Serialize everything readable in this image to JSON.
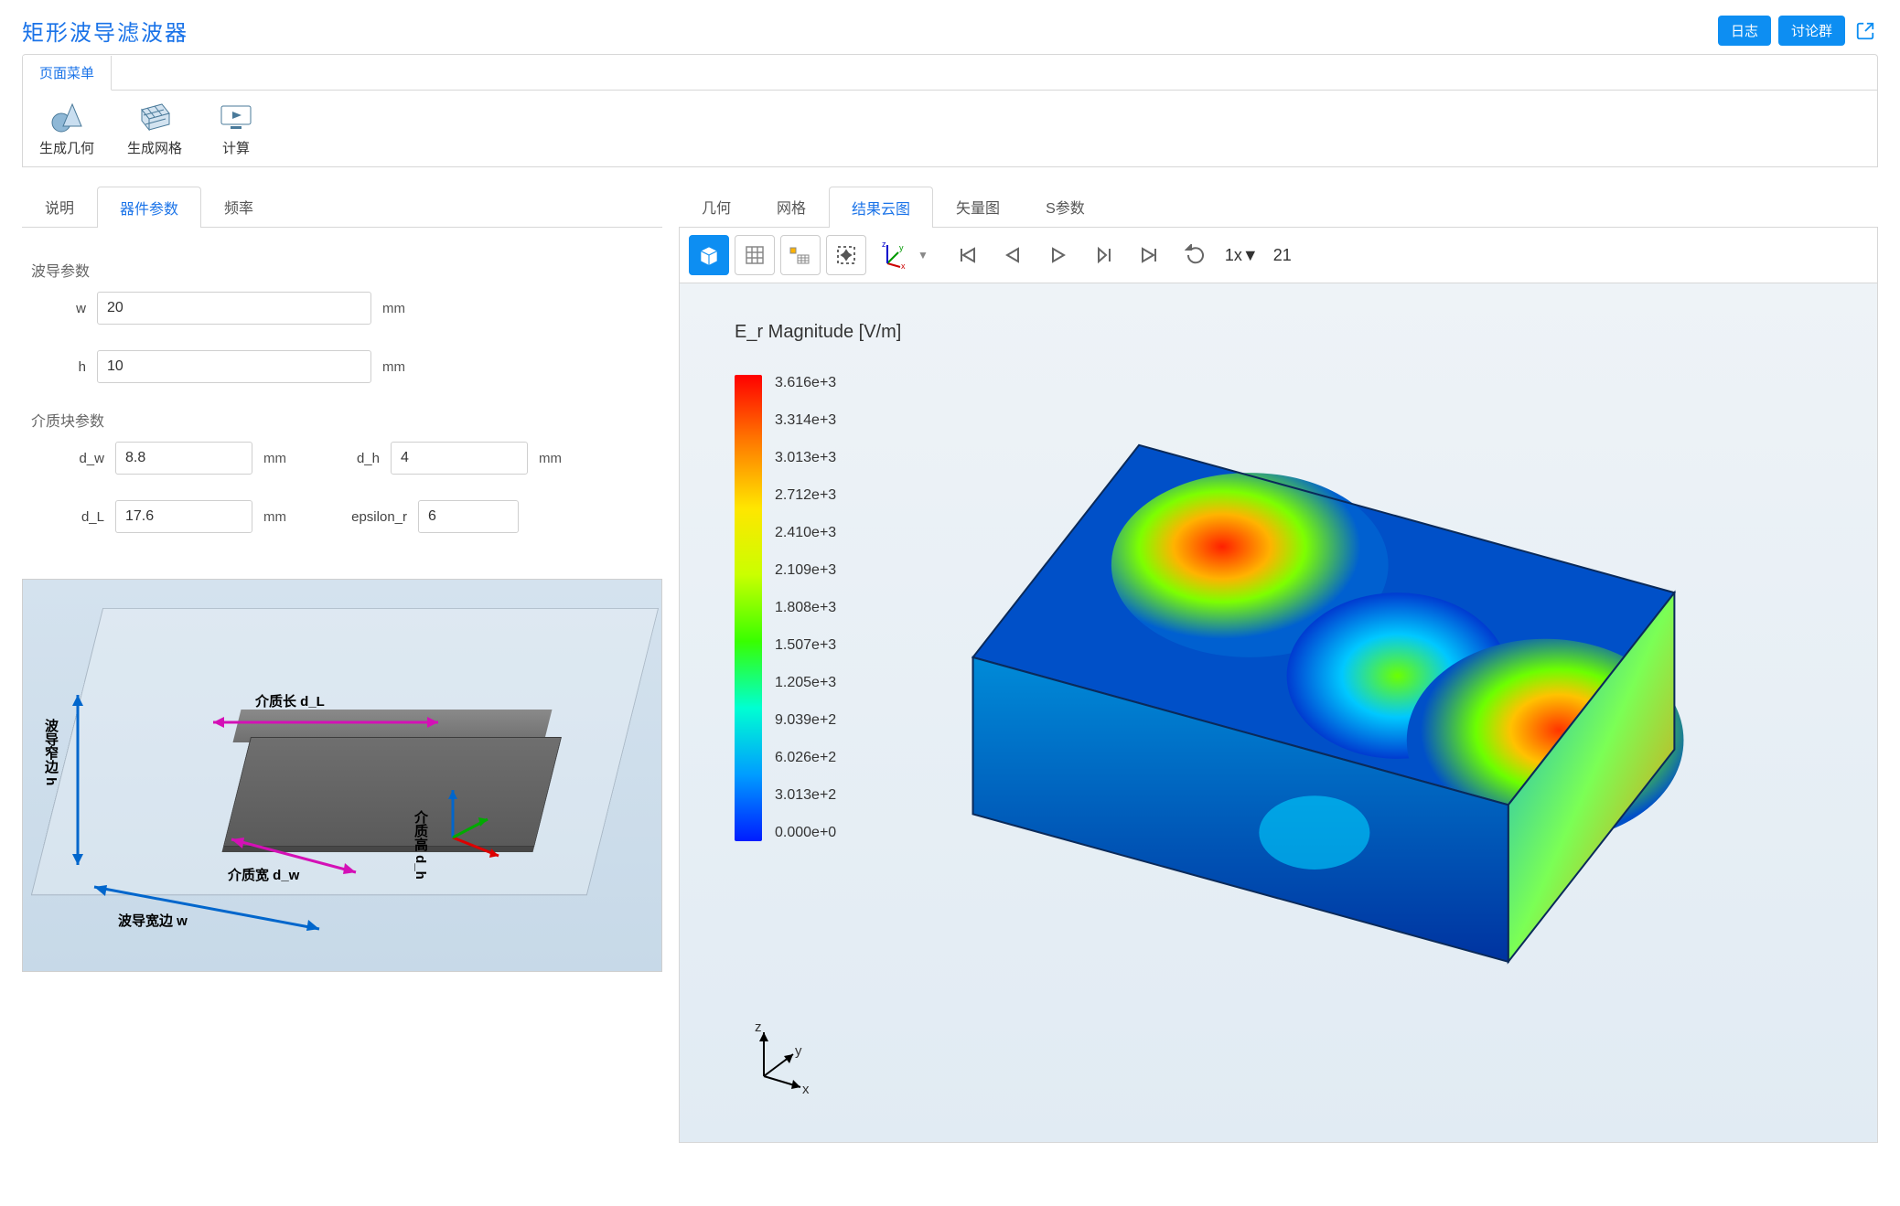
{
  "header": {
    "title": "矩形波导滤波器",
    "log_btn": "日志",
    "discuss_btn": "讨论群"
  },
  "menu_tab": "页面菜单",
  "ribbon": {
    "gen_geom": "生成几何",
    "gen_mesh": "生成网格",
    "compute": "计算"
  },
  "left_tabs": {
    "desc": "说明",
    "params": "器件参数",
    "freq": "频率"
  },
  "right_tabs": {
    "geom": "几何",
    "mesh": "网格",
    "contour": "结果云图",
    "vector": "矢量图",
    "spar": "S参数"
  },
  "form": {
    "wg_section": "波导参数",
    "diel_section": "介质块参数",
    "w_label": "w",
    "w_value": "20",
    "w_unit": "mm",
    "h_label": "h",
    "h_value": "10",
    "h_unit": "mm",
    "dw_label": "d_w",
    "dw_value": "8.8",
    "dw_unit": "mm",
    "dh_label": "d_h",
    "dh_value": "4",
    "dh_unit": "mm",
    "dL_label": "d_L",
    "dL_value": "17.6",
    "dL_unit": "mm",
    "er_label": "epsilon_r",
    "er_value": "6"
  },
  "schematic": {
    "label_dL": "介质长 d_L",
    "label_dw": "介质宽 d_w",
    "label_dh": "介质高 d_h",
    "label_wg_w": "波导宽边 w",
    "label_wg_h": "波导窄边 h"
  },
  "toolbar": {
    "step_mult": "1x▼",
    "frame": "21"
  },
  "plot": {
    "title": "E_r Magnitude [V/m]",
    "colorbar": [
      "3.616e+3",
      "3.314e+3",
      "3.013e+3",
      "2.712e+3",
      "2.410e+3",
      "2.109e+3",
      "1.808e+3",
      "1.507e+3",
      "1.205e+3",
      "9.039e+2",
      "6.026e+2",
      "3.013e+2",
      "0.000e+0"
    ],
    "triad": {
      "x": "x",
      "y": "y",
      "z": "z"
    }
  }
}
